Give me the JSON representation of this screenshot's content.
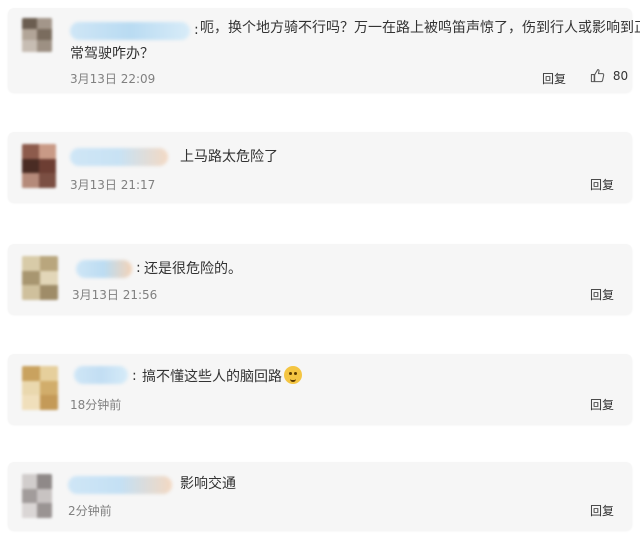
{
  "comments": [
    {
      "text_line1": "呃，换个地方骑不行吗？万一在路上被鸣笛声惊了，伤到行人或影响到正",
      "text_line2": "常驾驶咋办？",
      "time": "3月13日 22:09",
      "reply_label": "回复",
      "like_count": "80"
    },
    {
      "text": "上马路太危险了",
      "time": "3月13日 21:17",
      "reply_label": "回复"
    },
    {
      "text": "还是很危险的。",
      "time": "3月13日 21:56",
      "reply_label": "回复"
    },
    {
      "text": "搞不懂这些人的脑回路",
      "emoji": "doge-emoji",
      "time": "18分钟前",
      "reply_label": "回复"
    },
    {
      "text": "影响交通",
      "time": "2分钟前",
      "reply_label": "回复"
    }
  ],
  "colon": ":",
  "colors": {
    "card_bg": "#f6f6f6",
    "text": "#333333",
    "time": "#808080"
  },
  "icons": {
    "like": "thumbs-up-icon"
  }
}
